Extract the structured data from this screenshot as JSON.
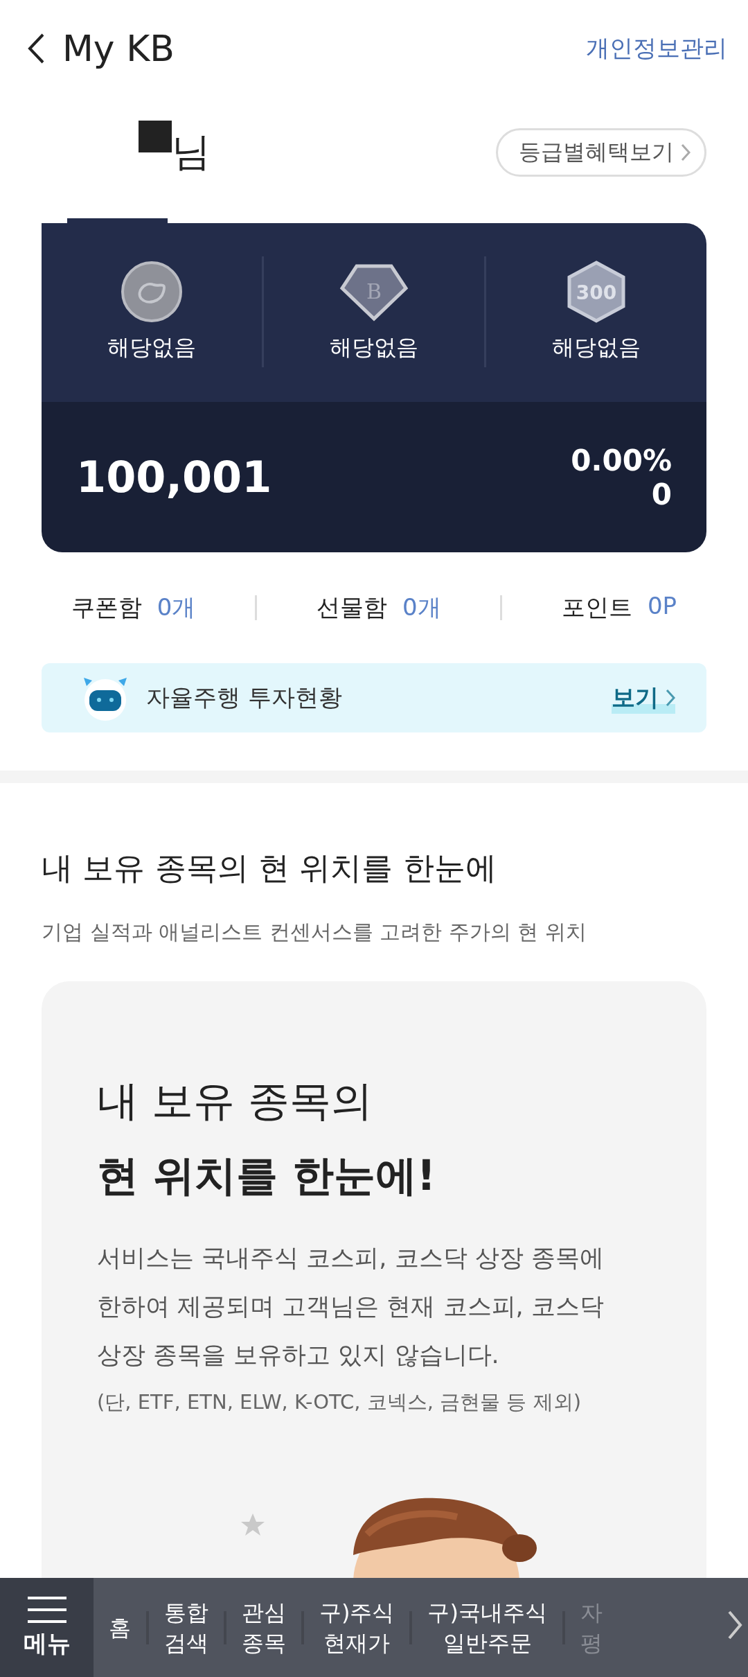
{
  "header": {
    "title": "My KB",
    "action": "개인정보관리"
  },
  "profile": {
    "suffix": "님",
    "benefits_button": "등급별혜택보기"
  },
  "summary_card": {
    "badges": [
      {
        "kind": "coin",
        "label": "해당없음"
      },
      {
        "kind": "diamond",
        "mark": "B",
        "label": "해당없음"
      },
      {
        "kind": "hexagon",
        "mark": "300",
        "label": "해당없음"
      }
    ],
    "amount": "100,001",
    "rate": "0.00%",
    "change": "0"
  },
  "boxes": [
    {
      "label": "쿠폰함",
      "value": "0개"
    },
    {
      "label": "선물함",
      "value": "0개"
    },
    {
      "label": "포인트",
      "value": "0P"
    }
  ],
  "banner": {
    "text": "자율주행 투자현황",
    "link": "보기"
  },
  "section": {
    "title": "내 보유 종목의 현 위치를 한눈에",
    "subtitle": "기업 실적과 애널리스트 컨센서스를 고려한 주가의 현 위치"
  },
  "info_card": {
    "heading_line1": "내 보유 종목의",
    "heading_line2": "현 위치를 한눈에!",
    "body_lines": [
      "서비스는 국내주식 코스피, 코스닥 상장 종목에",
      "한하여 제공되며 고객님은 현재 코스피, 코스닥",
      "상장 종목을 보유하고 있지 않습니다."
    ],
    "note": "(단, ETF, ETN, ELW, K-OTC, 코넥스, 금현물 등 제외)"
  },
  "bottom_nav": {
    "menu": "메뉴",
    "items": [
      {
        "lines": [
          "홈"
        ],
        "faded": false
      },
      {
        "lines": [
          "통합",
          "검색"
        ],
        "faded": false
      },
      {
        "lines": [
          "관심",
          "종목"
        ],
        "faded": false
      },
      {
        "lines": [
          "구)주식",
          "현재가"
        ],
        "faded": false
      },
      {
        "lines": [
          "구)국내주식",
          "일반주문"
        ],
        "faded": false
      },
      {
        "lines": [
          "자",
          "평"
        ],
        "faded": true
      }
    ]
  }
}
